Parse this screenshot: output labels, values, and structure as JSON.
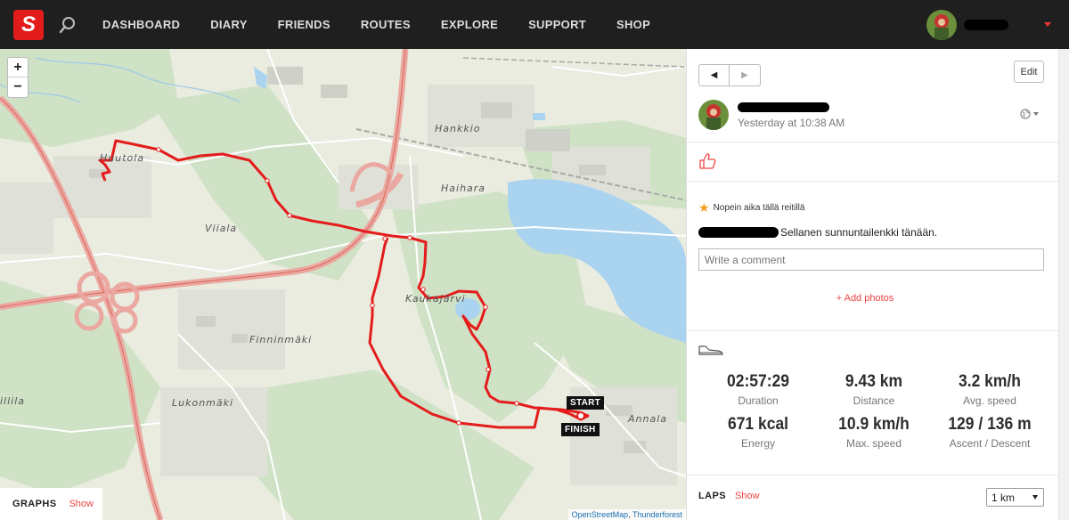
{
  "nav": {
    "logo": "S",
    "items": [
      "DASHBOARD",
      "DIARY",
      "FRIENDS",
      "ROUTES",
      "EXPLORE",
      "SUPPORT",
      "SHOP"
    ],
    "accent": "#e21b1b"
  },
  "map": {
    "zoom_in": "+",
    "zoom_out": "−",
    "places": [
      "Huutola",
      "Viiala",
      "Hankkio",
      "Haihara",
      "Kaukajärvi",
      "Finninmäki",
      "Lukonmäki",
      "Annala",
      "illila"
    ],
    "start_label": "START",
    "finish_label": "FINISH",
    "graphs_label": "GRAPHS",
    "graphs_show": "Show",
    "attribution_osm": "OpenStreetMap",
    "attribution_tf": "Thunderforest",
    "route_color": "#e51c1c",
    "water_color": "#aad3f0"
  },
  "panel": {
    "edit": "Edit",
    "time": "Yesterday at 10:38 AM",
    "badge": "Nopein aika tällä reitillä",
    "comment_text": "Sellanen sunnuntailenkki tänään.",
    "comment_placeholder": "Write a comment",
    "add_photos": "+ Add photos",
    "stats": [
      {
        "value": "02:57:29",
        "label": "Duration"
      },
      {
        "value": "9.43 km",
        "label": "Distance"
      },
      {
        "value": "3.2 km/h",
        "label": "Avg. speed"
      },
      {
        "value": "671 kcal",
        "label": "Energy"
      },
      {
        "value": "10.9 km/h",
        "label": "Max. speed"
      },
      {
        "value": "129 / 136 m",
        "label": "Ascent / Descent"
      }
    ],
    "laps_label": "LAPS",
    "laps_show": "Show",
    "lap_select": "1 km"
  }
}
